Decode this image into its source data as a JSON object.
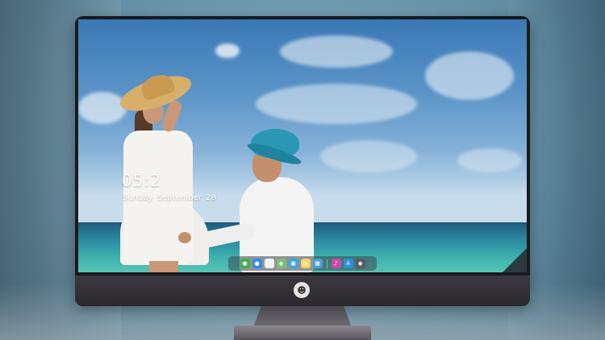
{
  "lockscreen": {
    "time": "05:2",
    "date": "Sunday September 28"
  },
  "dock": {
    "items": [
      {
        "name": "messages-icon",
        "glyph": "●",
        "color": "#3bb24a"
      },
      {
        "name": "chat-icon",
        "glyph": "●",
        "color": "#2f8fe0"
      },
      {
        "name": "clock-icon",
        "glyph": "◴",
        "color": "#f4f4f4"
      },
      {
        "name": "maps-icon",
        "glyph": "◆",
        "color": "#7cc272"
      },
      {
        "name": "finder-icon",
        "glyph": "▣",
        "color": "#3aa6d8"
      },
      {
        "name": "notes-icon",
        "glyph": "▤",
        "color": "#f3d45a"
      },
      {
        "name": "photos-icon",
        "glyph": "▦",
        "color": "#4a9fd8"
      },
      {
        "name": "music-icon",
        "glyph": "♪",
        "color": "#d04aa8"
      },
      {
        "name": "appstore-icon",
        "glyph": "A",
        "color": "#2f8fe0"
      },
      {
        "name": "camera-icon",
        "glyph": "◉",
        "color": "#555a60"
      }
    ]
  },
  "monitor": {
    "logo_glyph": "☻"
  }
}
